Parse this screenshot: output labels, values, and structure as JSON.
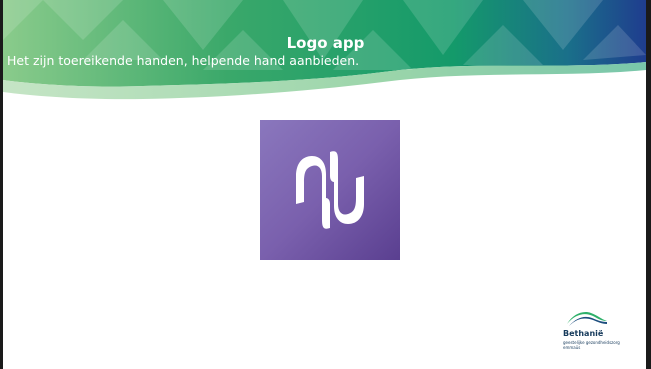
{
  "slide": {
    "title": "Logo app",
    "subtitle": "Het zijn toereikende handen, helpende hand aanbieden."
  },
  "app_logo": {
    "icon": "hands-logo-icon",
    "colors": {
      "background_light": "#8a75bb",
      "background_dark": "#5a3f90",
      "glyph": "#ffffff"
    }
  },
  "brand": {
    "name": "Bethanië",
    "tagline_line1": "geestelijke gezondheidszorg",
    "tagline_line2": "emmaüs",
    "icon": "bethanie-wave-icon",
    "colors": {
      "text": "#173b5c",
      "wave_green": "#2eb06a",
      "wave_blue": "#1d4e7e"
    }
  },
  "banner": {
    "colors": {
      "left": "#86c98a",
      "middle": "#1f9f5f",
      "right": "#1d3f8a"
    }
  }
}
